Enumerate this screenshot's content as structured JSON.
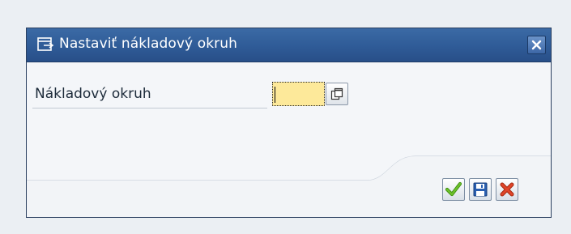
{
  "dialog": {
    "title": "Nastaviť nákladový okruh",
    "title_icon": "window-enter-icon",
    "close_icon": "close-icon"
  },
  "form": {
    "field_label": "Nákladový okruh",
    "field_value": "",
    "f4_icon": "value-help-icon"
  },
  "buttons": {
    "confirm_icon": "checkmark-icon",
    "save_icon": "save-icon",
    "cancel_icon": "cancel-x-icon"
  },
  "colors": {
    "titlebar": "#2f5b97",
    "input_bg": "#fde99a",
    "confirm": "#5cb024",
    "save": "#2a5fb0",
    "cancel": "#d83a1a"
  }
}
